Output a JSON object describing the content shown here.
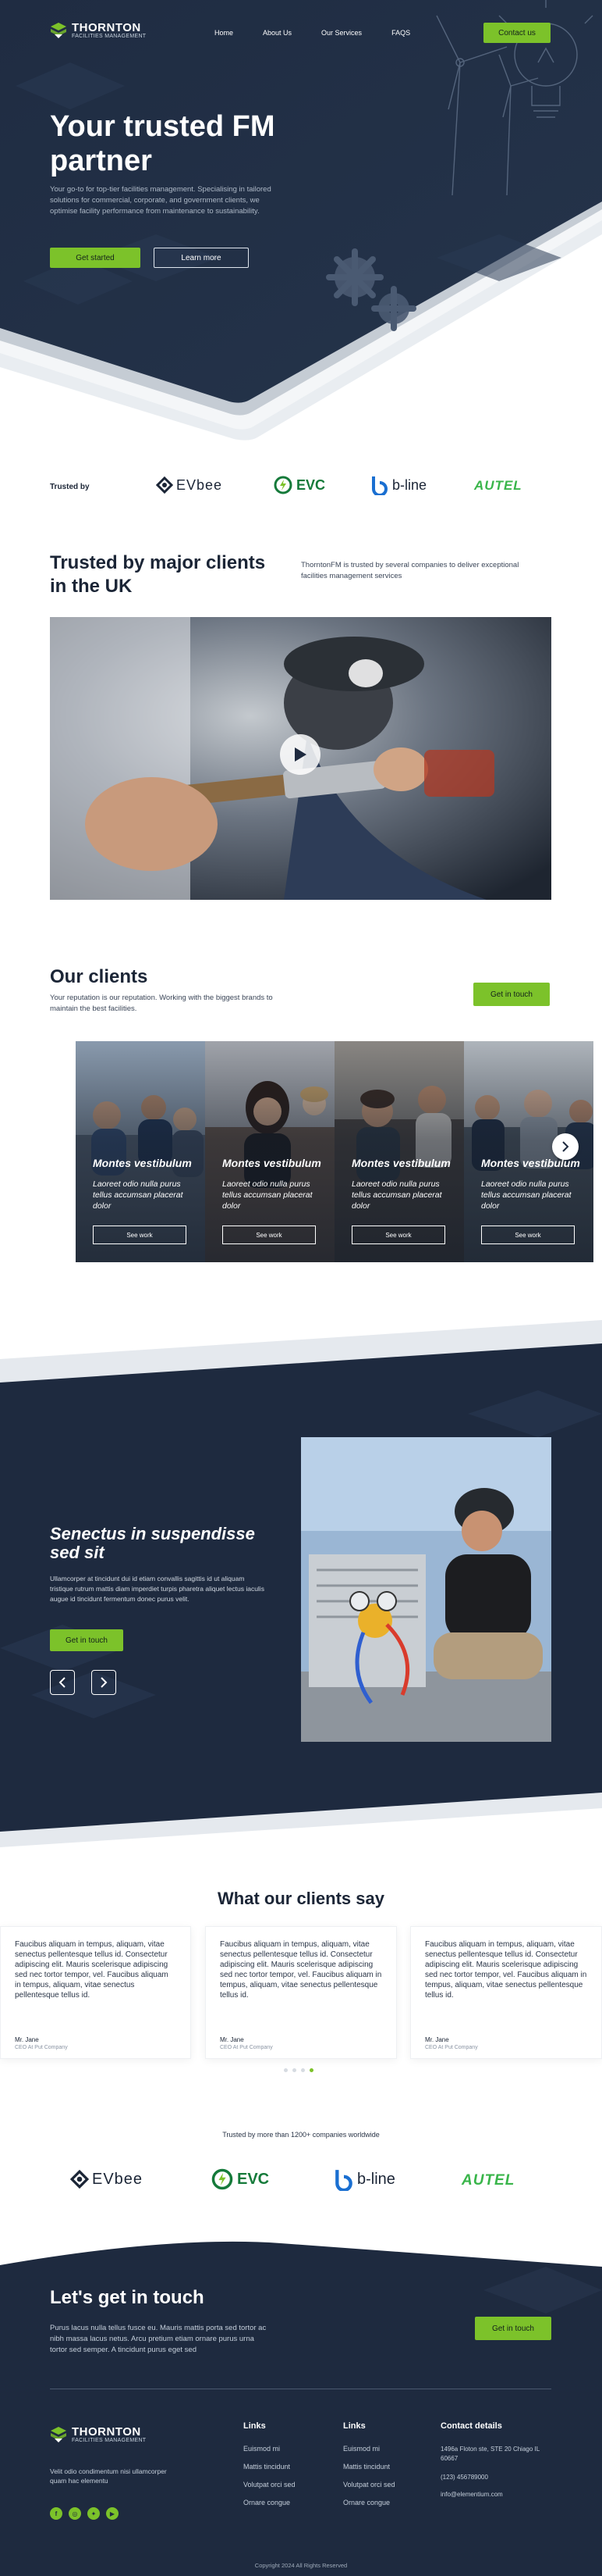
{
  "header": {
    "brand_name": "THORNTON",
    "brand_tagline": "FACILITIES MANAGEMENT",
    "nav": [
      "Home",
      "About Us",
      "Our Services",
      "FAQS"
    ],
    "cta": "Contact us"
  },
  "hero": {
    "title": "Your trusted FM partner",
    "subtitle": "Your go-to for top-tier facilities management. Specialising in tailored solutions for commercial, corporate, and government clients, we optimise facility performance from maintenance to sustainability.",
    "primary_button": "Get started",
    "secondary_button": "Learn more"
  },
  "trusted": {
    "label": "Trusted by",
    "logos": [
      "EVbee",
      "EVC",
      "b-line",
      "AUTEL"
    ]
  },
  "intro": {
    "title": "Trusted by major clients in the UK",
    "text": "ThorntonFM is trusted by several companies to deliver exceptional facilities management services"
  },
  "clients": {
    "title": "Our clients",
    "text": "Your reputation is our reputation. Working with the biggest brands to maintain the best facilities.",
    "button": "Get in touch",
    "cards": [
      {
        "title": "Montes vestibulum",
        "text": "Laoreet odio nulla purus tellus accumsan placerat dolor",
        "button": "See work"
      },
      {
        "title": "Montes vestibulum",
        "text": "Laoreet odio nulla purus tellus accumsan placerat dolor",
        "button": "See work"
      },
      {
        "title": "Montes vestibulum",
        "text": "Laoreet odio nulla purus tellus accumsan placerat dolor",
        "button": "See work"
      },
      {
        "title": "Montes vestibulum",
        "text": "Laoreet odio nulla purus tellus accumsan placerat dolor",
        "button": "See work"
      }
    ]
  },
  "feature": {
    "title": "Senectus in suspendisse sed sit",
    "text": "Ullamcorper at tincidunt dui id etiam convallis sagittis id ut aliquam tristique rutrum mattis diam imperdiet turpis pharetra aliquet lectus iaculis augue id tincidunt fermentum donec purus velit.",
    "button": "Get in touch"
  },
  "testimonials": {
    "title": "What our clients say",
    "items": [
      {
        "quote": "Faucibus aliquam in tempus, aliquam, vitae senectus pellentesque tellus id. Consectetur adipiscing elit. Mauris scelerisque adipiscing sed nec tortor tempor, vel. Faucibus aliquam in tempus, aliquam, vitae senectus pellentesque tellus id.",
        "name": "Mr. Jane",
        "role": "CEO At Put Company"
      },
      {
        "quote": "Faucibus aliquam in tempus, aliquam, vitae senectus pellentesque tellus id. Consectetur adipiscing elit. Mauris scelerisque adipiscing sed nec tortor tempor, vel. Faucibus aliquam in tempus, aliquam, vitae senectus pellentesque tellus id.",
        "name": "Mr. Jane",
        "role": "CEO At Put Company"
      },
      {
        "quote": "Faucibus aliquam in tempus, aliquam, vitae senectus pellentesque tellus id. Consectetur adipiscing elit. Mauris scelerisque adipiscing sed nec tortor tempor, vel. Faucibus aliquam in tempus, aliquam, vitae senectus pellentesque tellus id.",
        "name": "Mr. Jane",
        "role": "CEO At Put Company"
      }
    ]
  },
  "companies": {
    "label": "Trusted by more than 1200+ companies worldwide",
    "logos": [
      "EVbee",
      "EVC",
      "b-line",
      "AUTEL"
    ]
  },
  "cta_section": {
    "title": "Let's get in touch",
    "text": "Purus lacus nulla tellus fusce eu. Mauris mattis porta sed tortor ac nibh massa lacus netus. Arcu pretium etiam ornare purus urna tortor sed semper. A tincidunt purus eget sed",
    "button": "Get in touch"
  },
  "footer": {
    "description": "Velit odio condimentum nisi ullamcorper quam hac elementu",
    "col1": {
      "title": "Links",
      "items": [
        "Euismod mi",
        "Mattis tincidunt",
        "Volutpat orci sed",
        "Ornare congue"
      ]
    },
    "col2": {
      "title": "Links",
      "items": [
        "Euismod mi",
        "Mattis tincidunt",
        "Volutpat orci sed",
        "Ornare congue"
      ]
    },
    "contact": {
      "title": "Contact details",
      "address": "1496a Floton ste, STE 20 Chiago IL 60667",
      "phone": "(123) 456789000",
      "email": "info@elementium.com"
    },
    "copyright": "Copyright 2024 All Rights Reserved"
  },
  "colors": {
    "navy": "#1e2a3f",
    "accent": "#7cc22a"
  }
}
